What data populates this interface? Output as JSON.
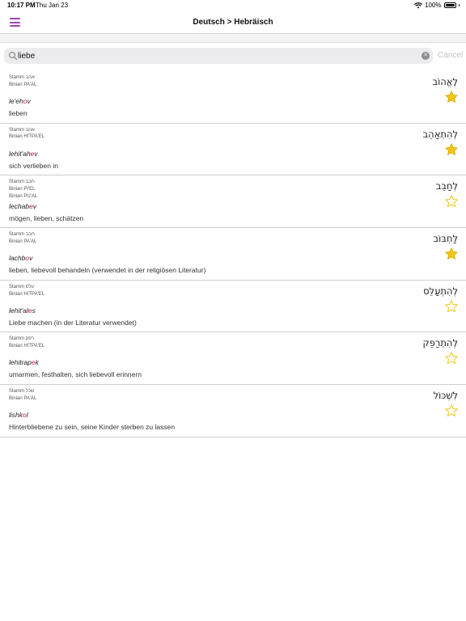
{
  "status_bar": {
    "time": "10:17 PM",
    "date": "Thu Jan 23",
    "battery": "100%"
  },
  "nav": {
    "title": "Deutsch > Hebräisch"
  },
  "search": {
    "value": "liebe",
    "placeholder": "",
    "cancel_label": "Cancel"
  },
  "colors": {
    "accent": "#9b46b6",
    "highlight": "#c2185b",
    "star_gold": "#f4c519"
  },
  "entries": [
    {
      "stamm": "Stamm אהב",
      "binian": [
        "Binian PA'AL"
      ],
      "translit_pre": "le'eh",
      "translit_hl": "o",
      "translit_post": "v",
      "meaning": "lieben",
      "hebrew": "לֶאֱהוֹב",
      "favorite": true
    },
    {
      "stamm": "Stamm אהב",
      "binian": [
        "Binian HITPA'EL"
      ],
      "translit_pre": "lehit'ah",
      "translit_hl": "e",
      "translit_post": "v",
      "meaning": "sich verlieben in",
      "hebrew": "לְהִתְאַהֵב",
      "favorite": true
    },
    {
      "stamm": "Stamm חבב",
      "binian": [
        "Binian PI'EL",
        "Binian PU'AL"
      ],
      "translit_pre": "lechab",
      "translit_hl": "e",
      "translit_post": "v",
      "meaning": "mögen, lieben, schätzen",
      "hebrew": "לְחַבֵּב",
      "favorite": false
    },
    {
      "stamm": "Stamm חבב",
      "binian": [
        "Binian PA'AL"
      ],
      "translit_pre": "lachb",
      "translit_hl": "o",
      "translit_post": "v",
      "meaning": "lieben, liebevoll behandeln (verwendet in der religiösen Literatur)",
      "hebrew": "לַחְבּוֹב",
      "favorite": true
    },
    {
      "stamm": "Stamm עלס",
      "binian": [
        "Binian HITPA'EL"
      ],
      "translit_pre": "lehit'al",
      "translit_hl": "e",
      "translit_post": "s",
      "meaning": "Liebe machen (in der Literatur verwendet)",
      "hebrew": "לְהִתְעַלֵּס",
      "favorite": false
    },
    {
      "stamm": "Stamm רפק",
      "binian": [
        "Binian HITPA'EL"
      ],
      "translit_pre": "lehitrap",
      "translit_hl": "e",
      "translit_post": "k",
      "meaning": "umarmen, festhalten, sich liebevoll erinnern",
      "hebrew": "לְהִתְרַפֵּק",
      "favorite": false
    },
    {
      "stamm": "Stamm שכל",
      "binian": [
        "Binian PA'AL"
      ],
      "translit_pre": "lishk",
      "translit_hl": "o",
      "translit_post": "l",
      "meaning": "Hinterbliebene zu sein, seine Kinder sterben zu lassen",
      "hebrew": "לִשְׁכּוֹל",
      "favorite": false
    }
  ]
}
